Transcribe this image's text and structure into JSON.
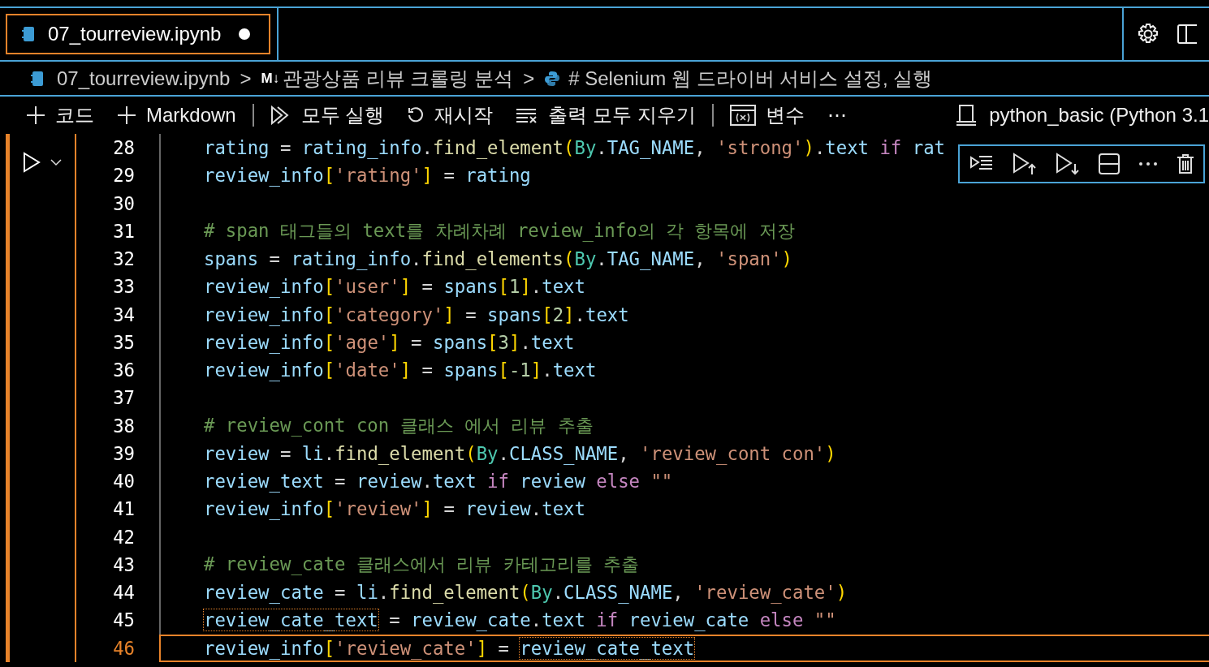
{
  "tab": {
    "title": "07_tourreview.ipynb",
    "modified": true,
    "selected": true
  },
  "breadcrumbs": [
    {
      "kind": "notebook",
      "text": "07_tourreview.ipynb"
    },
    {
      "kind": "markdown",
      "separator": ">",
      "icon_text": "M↓",
      "text": "관광상품 리뷰 크롤링 분석"
    },
    {
      "kind": "python",
      "separator": ">",
      "text": "# Selenium 웹 드라이버 서비스 설정, 실행"
    }
  ],
  "toolbar": [
    {
      "kind": "plus",
      "text": "코드"
    },
    {
      "kind": "plus",
      "text": "Markdown"
    },
    {
      "kind": "sep"
    },
    {
      "kind": "runall",
      "text": "모두 실행"
    },
    {
      "kind": "restart",
      "text": "재시작"
    },
    {
      "kind": "clear",
      "text": "출력 모두 지우기"
    },
    {
      "kind": "sep"
    },
    {
      "kind": "variables",
      "text": "변수"
    },
    {
      "kind": "more",
      "text": "⋯"
    }
  ],
  "kernel": "python_basic (Python 3.1",
  "lines": [
    {
      "n": "28",
      "current": false,
      "tokens": [
        {
          "kind": "var",
          "text": "rating"
        },
        {
          "kind": "op",
          "text": " = "
        },
        {
          "kind": "var",
          "text": "rating_info"
        },
        {
          "kind": "op",
          "text": "."
        },
        {
          "kind": "fn",
          "text": "find_element"
        },
        {
          "kind": "br",
          "text": "("
        },
        {
          "kind": "cls",
          "text": "By"
        },
        {
          "kind": "op",
          "text": "."
        },
        {
          "kind": "var",
          "text": "TAG_NAME"
        },
        {
          "kind": "op",
          "text": ", "
        },
        {
          "kind": "str",
          "text": "'strong'"
        },
        {
          "kind": "br",
          "text": ")"
        },
        {
          "kind": "op",
          "text": "."
        },
        {
          "kind": "var",
          "text": "text"
        },
        {
          "kind": "kw",
          "text": " if "
        },
        {
          "kind": "var",
          "text": "rat"
        }
      ]
    },
    {
      "n": "29",
      "current": false,
      "tokens": [
        {
          "kind": "var",
          "text": "review_info"
        },
        {
          "kind": "br",
          "text": "["
        },
        {
          "kind": "str",
          "text": "'rating'"
        },
        {
          "kind": "br",
          "text": "]"
        },
        {
          "kind": "op",
          "text": " = "
        },
        {
          "kind": "var",
          "text": "rating"
        }
      ]
    },
    {
      "n": "30",
      "current": false
    },
    {
      "n": "31",
      "current": false,
      "tokens": [
        {
          "kind": "cm",
          "text": "# span 태그들의 text를 차례차례 review_info의 각 항목에 저장"
        }
      ]
    },
    {
      "n": "32",
      "current": false,
      "tokens": [
        {
          "kind": "var",
          "text": "spans"
        },
        {
          "kind": "op",
          "text": " = "
        },
        {
          "kind": "var",
          "text": "rating_info"
        },
        {
          "kind": "op",
          "text": "."
        },
        {
          "kind": "fn",
          "text": "find_elements"
        },
        {
          "kind": "br",
          "text": "("
        },
        {
          "kind": "cls",
          "text": "By"
        },
        {
          "kind": "op",
          "text": "."
        },
        {
          "kind": "var",
          "text": "TAG_NAME"
        },
        {
          "kind": "op",
          "text": ", "
        },
        {
          "kind": "str",
          "text": "'span'"
        },
        {
          "kind": "br",
          "text": ")"
        }
      ]
    },
    {
      "n": "33",
      "current": false,
      "tokens": [
        {
          "kind": "var",
          "text": "review_info"
        },
        {
          "kind": "br",
          "text": "["
        },
        {
          "kind": "str",
          "text": "'user'"
        },
        {
          "kind": "br",
          "text": "]"
        },
        {
          "kind": "op",
          "text": " = "
        },
        {
          "kind": "var",
          "text": "spans"
        },
        {
          "kind": "br",
          "text": "["
        },
        {
          "kind": "num",
          "text": "1"
        },
        {
          "kind": "br",
          "text": "]"
        },
        {
          "kind": "op",
          "text": "."
        },
        {
          "kind": "var",
          "text": "text"
        }
      ]
    },
    {
      "n": "34",
      "current": false,
      "tokens": [
        {
          "kind": "var",
          "text": "review_info"
        },
        {
          "kind": "br",
          "text": "["
        },
        {
          "kind": "str",
          "text": "'category'"
        },
        {
          "kind": "br",
          "text": "]"
        },
        {
          "kind": "op",
          "text": " = "
        },
        {
          "kind": "var",
          "text": "spans"
        },
        {
          "kind": "br",
          "text": "["
        },
        {
          "kind": "num",
          "text": "2"
        },
        {
          "kind": "br",
          "text": "]"
        },
        {
          "kind": "op",
          "text": "."
        },
        {
          "kind": "var",
          "text": "text"
        }
      ]
    },
    {
      "n": "35",
      "current": false,
      "tokens": [
        {
          "kind": "var",
          "text": "review_info"
        },
        {
          "kind": "br",
          "text": "["
        },
        {
          "kind": "str",
          "text": "'age'"
        },
        {
          "kind": "br",
          "text": "]"
        },
        {
          "kind": "op",
          "text": " = "
        },
        {
          "kind": "var",
          "text": "spans"
        },
        {
          "kind": "br",
          "text": "["
        },
        {
          "kind": "num",
          "text": "3"
        },
        {
          "kind": "br",
          "text": "]"
        },
        {
          "kind": "op",
          "text": "."
        },
        {
          "kind": "var",
          "text": "text"
        }
      ]
    },
    {
      "n": "36",
      "current": false,
      "tokens": [
        {
          "kind": "var",
          "text": "review_info"
        },
        {
          "kind": "br",
          "text": "["
        },
        {
          "kind": "str",
          "text": "'date'"
        },
        {
          "kind": "br",
          "text": "]"
        },
        {
          "kind": "op",
          "text": " = "
        },
        {
          "kind": "var",
          "text": "spans"
        },
        {
          "kind": "br",
          "text": "["
        },
        {
          "kind": "num",
          "text": "-1"
        },
        {
          "kind": "br",
          "text": "]"
        },
        {
          "kind": "op",
          "text": "."
        },
        {
          "kind": "var",
          "text": "text"
        }
      ]
    },
    {
      "n": "37",
      "current": false
    },
    {
      "n": "38",
      "current": false,
      "tokens": [
        {
          "kind": "cm",
          "text": "# review_cont con 클래스 에서 리뷰 추출"
        }
      ]
    },
    {
      "n": "39",
      "current": false,
      "tokens": [
        {
          "kind": "var",
          "text": "review"
        },
        {
          "kind": "op",
          "text": " = "
        },
        {
          "kind": "var",
          "text": "li"
        },
        {
          "kind": "op",
          "text": "."
        },
        {
          "kind": "fn",
          "text": "find_element"
        },
        {
          "kind": "br",
          "text": "("
        },
        {
          "kind": "cls",
          "text": "By"
        },
        {
          "kind": "op",
          "text": "."
        },
        {
          "kind": "var",
          "text": "CLASS_NAME"
        },
        {
          "kind": "op",
          "text": ", "
        },
        {
          "kind": "str",
          "text": "'review_cont con'"
        },
        {
          "kind": "br",
          "text": ")"
        }
      ]
    },
    {
      "n": "40",
      "current": false,
      "tokens": [
        {
          "kind": "var",
          "text": "review_text"
        },
        {
          "kind": "op",
          "text": " = "
        },
        {
          "kind": "var",
          "text": "review"
        },
        {
          "kind": "op",
          "text": "."
        },
        {
          "kind": "var",
          "text": "text"
        },
        {
          "kind": "kw",
          "text": " if "
        },
        {
          "kind": "var",
          "text": "review"
        },
        {
          "kind": "kw",
          "text": " else "
        },
        {
          "kind": "str",
          "text": "\"\""
        }
      ]
    },
    {
      "n": "41",
      "current": false,
      "tokens": [
        {
          "kind": "var",
          "text": "review_info"
        },
        {
          "kind": "br",
          "text": "["
        },
        {
          "kind": "str",
          "text": "'review'"
        },
        {
          "kind": "br",
          "text": "]"
        },
        {
          "kind": "op",
          "text": " = "
        },
        {
          "kind": "var",
          "text": "review"
        },
        {
          "kind": "op",
          "text": "."
        },
        {
          "kind": "var",
          "text": "text"
        }
      ]
    },
    {
      "n": "42",
      "current": false
    },
    {
      "n": "43",
      "current": false,
      "tokens": [
        {
          "kind": "cm",
          "text": "# review_cate 클래스에서 리뷰 카테고리를 추출"
        }
      ]
    },
    {
      "n": "44",
      "current": false,
      "tokens": [
        {
          "kind": "var",
          "text": "review_cate"
        },
        {
          "kind": "op",
          "text": " = "
        },
        {
          "kind": "var",
          "text": "li"
        },
        {
          "kind": "op",
          "text": "."
        },
        {
          "kind": "fn",
          "text": "find_element"
        },
        {
          "kind": "br",
          "text": "("
        },
        {
          "kind": "cls",
          "text": "By"
        },
        {
          "kind": "op",
          "text": "."
        },
        {
          "kind": "var",
          "text": "CLASS_NAME"
        },
        {
          "kind": "op",
          "text": ", "
        },
        {
          "kind": "str",
          "text": "'review_cate'"
        },
        {
          "kind": "br",
          "text": ")"
        }
      ]
    },
    {
      "n": "45",
      "current": false,
      "tokens": [
        {
          "kind": "match",
          "text": "review_cate_text"
        },
        {
          "kind": "op",
          "text": " = "
        },
        {
          "kind": "var",
          "text": "review_cate"
        },
        {
          "kind": "op",
          "text": "."
        },
        {
          "kind": "var",
          "text": "text"
        },
        {
          "kind": "kw",
          "text": " if "
        },
        {
          "kind": "var",
          "text": "review_cate"
        },
        {
          "kind": "kw",
          "text": " else "
        },
        {
          "kind": "str",
          "text": "\"\""
        }
      ]
    },
    {
      "n": "46",
      "current": true,
      "tokens": [
        {
          "kind": "var",
          "text": "review_info"
        },
        {
          "kind": "br",
          "text": "["
        },
        {
          "kind": "str",
          "text": "'review_cate'"
        },
        {
          "kind": "br",
          "text": "]"
        },
        {
          "kind": "op",
          "text": " = "
        },
        {
          "kind": "match",
          "text": "review_cate_text"
        }
      ]
    }
  ]
}
